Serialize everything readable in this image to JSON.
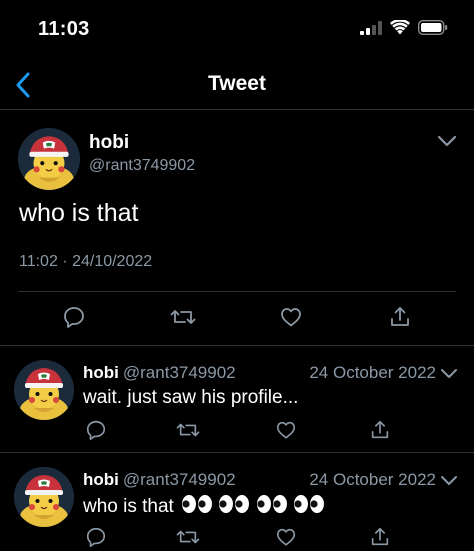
{
  "status_bar": {
    "time": "11:03",
    "icons": [
      "cellular-signal-icon",
      "wifi-icon",
      "battery-icon"
    ]
  },
  "nav": {
    "title": "Tweet",
    "back_icon": "chevron-left-icon"
  },
  "main_tweet": {
    "display_name": "hobi",
    "handle": "@rant3749902",
    "text": "who is that",
    "timestamp": "11:02 · 24/10/2022",
    "actions": [
      "reply-icon",
      "retweet-icon",
      "like-icon",
      "share-icon"
    ]
  },
  "replies": [
    {
      "display_name": "hobi",
      "handle": "@rant3749902",
      "date": "24 October 2022",
      "text": "wait. just saw his profile..."
    },
    {
      "display_name": "hobi",
      "handle": "@rant3749902",
      "date": "24 October 2022",
      "text": "who is that",
      "emoji": [
        "👀",
        "👀",
        "👀",
        "👀"
      ]
    }
  ],
  "colors": {
    "background": "#000000",
    "accent": "#1d9bf0",
    "secondary_text": "#8b98a5",
    "divider": "#2f3336"
  }
}
